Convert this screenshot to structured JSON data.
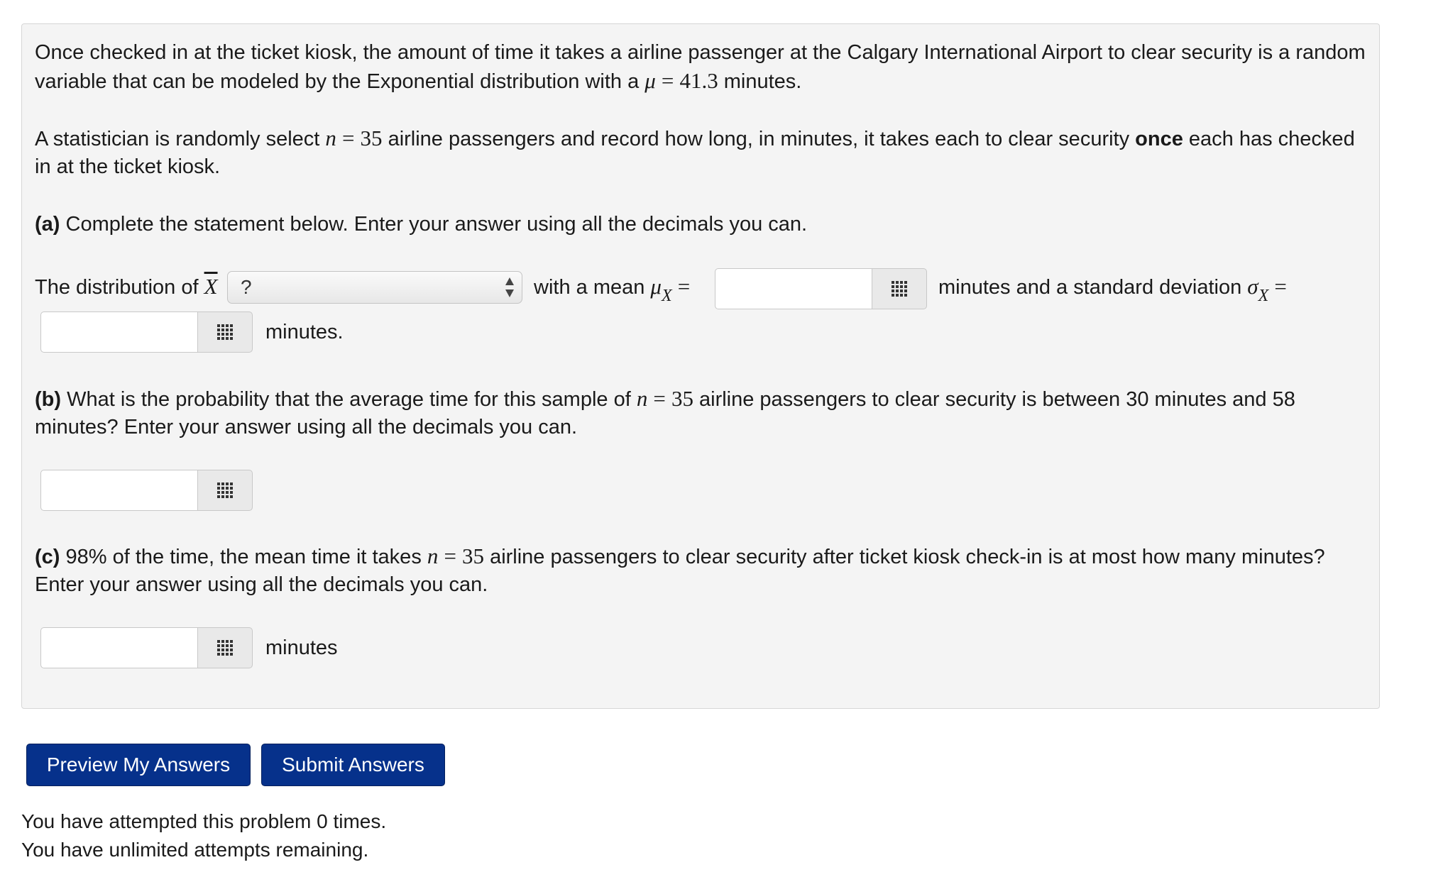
{
  "problem": {
    "intro": {
      "line1": "Once checked in at the ticket kiosk, the amount of time it takes a airline passenger at the Calgary International Airport to clear security is a random",
      "line2_prefix": "variable that can be modeled by the Exponential distribution with a",
      "mu_symbol": "μ",
      "equals": "=",
      "mu_value": "41.3",
      "line2_suffix": "minutes."
    },
    "sample": {
      "prefix": "A statistician is randomly select",
      "n_symbol": "n",
      "equals": "=",
      "n_value": "35",
      "middle": "airline passengers and record how long, in minutes, it takes each to clear security",
      "bold_word": "once",
      "suffix": "each has checked",
      "line2": "in at the ticket kiosk."
    },
    "part_a": {
      "label": "(a)",
      "instruction": "Complete the statement below. Enter your answer using all the decimals you can.",
      "stmt_prefix": "The distribution of",
      "xbar": "X",
      "select_value": "?",
      "with_mean": "with a mean",
      "mu_x": "μ",
      "sub_x": "X",
      "equals": "=",
      "minutes_and_sd": "minutes and a standard deviation",
      "sigma_x": "σ",
      "minutes_end": "minutes."
    },
    "part_b": {
      "label": "(b)",
      "line1_prefix": "What is the probability that the average time for this sample of",
      "n_symbol": "n",
      "equals": "=",
      "n_value": "35",
      "line1_suffix": "airline passengers to clear security is between 30 minutes and 58",
      "line2": "minutes? Enter your answer using all the decimals you can."
    },
    "part_c": {
      "label": "(c)",
      "line1_prefix": "98% of the time, the mean time it takes",
      "n_symbol": "n",
      "equals": "=",
      "n_value": "35",
      "line1_suffix": "airline passengers to clear security after ticket kiosk check-in is at most how many minutes?",
      "line2": "Enter your answer using all the decimals you can.",
      "unit": "minutes"
    }
  },
  "buttons": {
    "preview": "Preview My Answers",
    "submit": "Submit Answers"
  },
  "status": {
    "attempts": "You have attempted this problem 0 times.",
    "remaining": "You have unlimited attempts remaining."
  },
  "colors": {
    "button_bg": "#06318b",
    "panel_bg": "#f4f4f4"
  }
}
